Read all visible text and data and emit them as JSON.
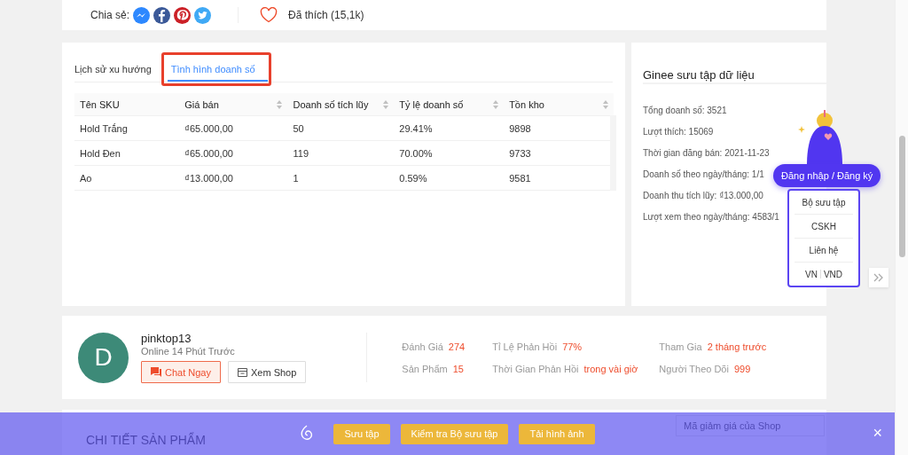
{
  "share": {
    "label": "Chia sẻ:",
    "liked": "Đã thích (15,1k)"
  },
  "tabs": [
    {
      "label": "Lịch sử xu hướng",
      "selected": false
    },
    {
      "label": "Tình hình doanh số",
      "selected": true
    }
  ],
  "table": {
    "columns": [
      {
        "label": "Tên SKU",
        "sortable": false
      },
      {
        "label": "Giá bán",
        "sortable": true
      },
      {
        "label": "Doanh số tích lũy",
        "sortable": true
      },
      {
        "label": "Tỷ lệ doanh số",
        "sortable": true
      },
      {
        "label": "Tồn kho",
        "sortable": true
      }
    ],
    "rows": [
      [
        "Hold Trắng",
        "₫65.000,00",
        "50",
        "29.41%",
        "9898"
      ],
      [
        "Hold Đen",
        "₫65.000,00",
        "119",
        "70.00%",
        "9733"
      ],
      [
        "Ao",
        "₫13.000,00",
        "1",
        "0.59%",
        "9581"
      ]
    ]
  },
  "data_panel": {
    "title": "Ginee sưu tập dữ liệu",
    "lines": [
      "Tổng doanh số: 3521",
      "Lượt thích: 15069",
      "Thời gian đăng bán: 2021-11-23",
      "Doanh số theo ngày/tháng: 1/1",
      "Doanh thu tích lũy: ₫13.000,00",
      "Lượt xem theo ngày/tháng: 4583/1"
    ]
  },
  "shop": {
    "avatar_letter": "D",
    "name": "pinktop13",
    "status": "Online 14 Phút Trước",
    "buttons": [
      "Chat Ngay",
      "Xem Shop"
    ],
    "stats": [
      {
        "label": "Đánh Giá",
        "value": "274"
      },
      {
        "label": "Tỉ Lệ Phản Hồi",
        "value": "77%"
      },
      {
        "label": "Tham Gia",
        "value": "2 tháng trước"
      },
      {
        "label": "Sản Phẩm",
        "value": "15"
      },
      {
        "label": "Thời Gian Phản Hồi",
        "value": "trong vài giờ"
      },
      {
        "label": "Người Theo Dõi",
        "value": "999"
      }
    ]
  },
  "details": {
    "heading": "CHI TIẾT SẢN PHẨM",
    "voucher_placeholder": "Mã giảm giá của Shop"
  },
  "widget": {
    "login": "Đăng nhập / Đăng ký",
    "menu": [
      "Bộ sưu tập",
      "CSKH",
      "Liên hệ"
    ],
    "language": "VN",
    "currency": "VND"
  },
  "bottom_bar": {
    "buttons": [
      "Sưu tập",
      "Kiểm tra Bộ sưu tập",
      "Tải hình ảnh"
    ],
    "close": "×"
  }
}
